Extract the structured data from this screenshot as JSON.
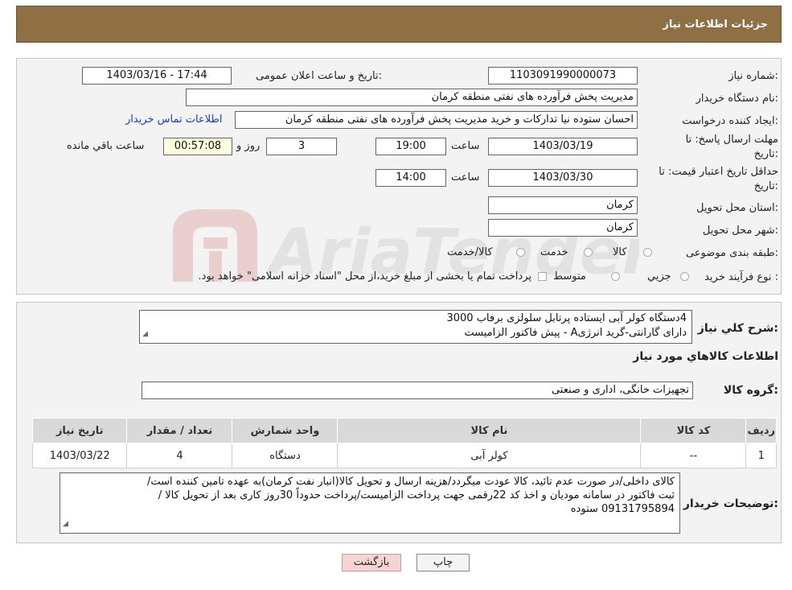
{
  "page_title": "جزئیات اطلاعات نیاز",
  "labels": {
    "need_number": "شماره نیاز:",
    "announce_datetime": "تاریخ و ساعت اعلان عمومی:",
    "buyer_org": "نام دستگاه خریدار:",
    "requester": "ایجاد کننده درخواست:",
    "contact_link": "اطلاعات تماس خریدار",
    "deadline_line1": "مهلت ارسال پاسخ: تا",
    "deadline_line2": "تاریخ:",
    "time": "ساعت",
    "days_and": "روز و",
    "remaining": "ساعت باقي مانده",
    "validity_line1": "حداقل تاریخ اعتبار قیمت: تا",
    "validity_line2": "تاریخ:",
    "province": "استان محل تحویل:",
    "city": "شهر محل تحویل:",
    "category": "طبقه بندی موضوعی:",
    "purchase_type": "نوع فرآیند خرید :",
    "general_desc": "شرح کلي نياز:",
    "goods_info": "اطلاعات کالاهاي مورد نياز",
    "goods_group": "گروه کالا:",
    "buyer_notes": "توضیحات خریدار:"
  },
  "fields": {
    "need_number": "1103091990000073",
    "announce_datetime": "1403/03/16 - 17:44",
    "buyer_org": "مدیریت پخش فرآورده های نفتی منطقه کرمان",
    "requester": "احسان  ستوده نیا  تدارکات و خرید  مدیریت پخش فرآورده های نفتی منطقه کرمان",
    "deadline_date": "1403/03/19",
    "deadline_time": "19:00",
    "days": "3",
    "countdown": "00:57:08",
    "validity_date": "1403/03/30",
    "validity_time": "14:00",
    "province": "کرمان",
    "city": "کرمان",
    "goods_group": "تجهیزات خانگی، اداری و صنعتی"
  },
  "category_options": [
    "کالا",
    "خدمت",
    "کالا/خدمت"
  ],
  "purchase_options": [
    "جزيي",
    "متوسط"
  ],
  "purchase_note": "پرداخت تمام یا بخشی از مبلغ خرید،از محل \"اسناد خزانه اسلامی\" خواهد بود.",
  "general_description": {
    "line1": "4دستگاه کولر آبی ایستاده پرتابل سلولزی برفاب 3000",
    "line2": "دارای گارانتی-گرید انرژیA - پیش فاکتور الزامیست"
  },
  "table": {
    "headers": [
      "ردیف",
      "کد کالا",
      "نام کالا",
      "واحد شمارش",
      "تعداد / مقدار",
      "تاریخ نیاز"
    ],
    "rows": [
      [
        "1",
        "--",
        "کولر آبی",
        "دستگاه",
        "4",
        "1403/03/22"
      ]
    ]
  },
  "buyer_notes": {
    "line1": "کالای داخلی/در صورت عدم تائید، کالا عودت میگردد/هزینه ارسال و تحویل کالا(انبار نفت کرمان)به عهده تامین کننده است/",
    "line2": "ثبت فاکتور در سامانه مودیان و اخذ کد 22رقمی جهت پرداخت الزامیست/پرداخت حدوداً 30روز کاری بعد از تحویل کالا /",
    "line3": "09131795894 ستوده"
  },
  "buttons": {
    "back": "بازگشت",
    "print": "چاپ"
  },
  "watermark": "AriaTender.neT",
  "colors": {
    "header": "#8e7044",
    "link": "#1a3ccc",
    "back_button": "#f7d4d4"
  }
}
